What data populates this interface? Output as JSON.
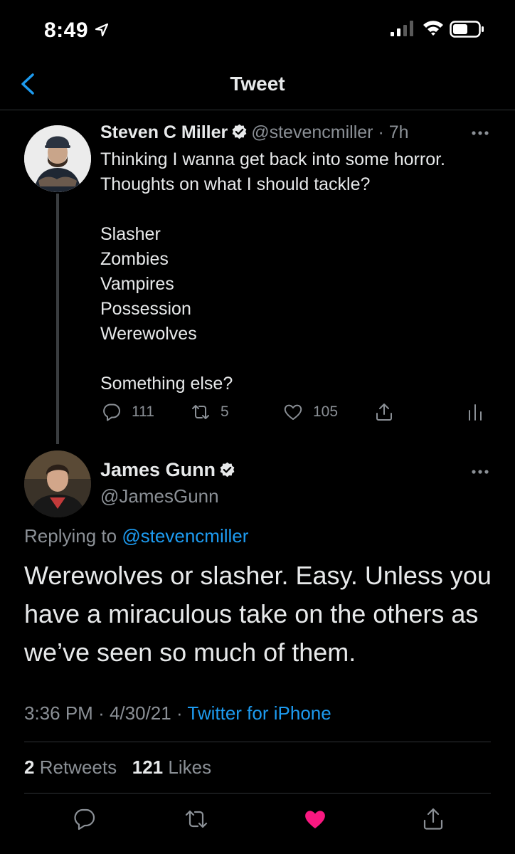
{
  "status_bar": {
    "time": "8:49"
  },
  "nav": {
    "title": "Tweet"
  },
  "parent_tweet": {
    "name": "Steven C Miller",
    "handle": "@stevencmiller",
    "separator": "·",
    "age": "7h",
    "text": "Thinking I wanna get back into some horror. Thoughts on what I should tackle?\n\nSlasher\nZombies\nVampires\nPossession\nWerewolves\n\nSomething else?",
    "replies": "111",
    "retweets": "5",
    "likes": "105"
  },
  "main_tweet": {
    "name": "James Gunn",
    "handle": "@JamesGunn",
    "replying_prefix": "Replying to",
    "replying_to": "@stevencmiller",
    "text": "Werewolves or slasher. Easy. Unless you have a miraculous take on the others as we’ve seen so much of them.",
    "time": "3:36 PM",
    "date": "4/30/21",
    "separator": "·",
    "source": "Twitter for iPhone",
    "retweet_count": "2",
    "retweet_label": "Retweets",
    "like_count": "121",
    "like_label": "Likes",
    "liked": true
  },
  "colors": {
    "accent": "#1d9bf0",
    "like": "#f91880",
    "secondary_text": "#8b9096"
  }
}
